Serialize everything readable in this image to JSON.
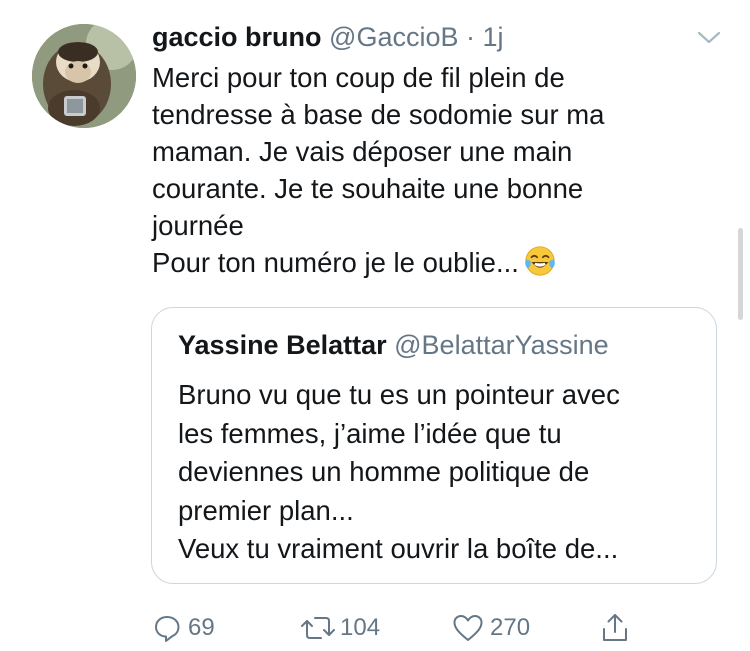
{
  "tweet": {
    "author_name": "gaccio bruno",
    "handle": "@GaccioB",
    "separator": "·",
    "time": "1j",
    "text_lines": [
      "Merci pour ton coup de fil plein de",
      "tendresse à base de sodomie sur ma",
      "maman. Je vais déposer une main",
      "courante. Je te souhaite une bonne",
      "journée",
      "Pour ton numéro je le oublie..."
    ],
    "emoji": "face-with-tears-of-joy"
  },
  "quoted_tweet": {
    "author_name": "Yassine Belattar",
    "handle": "@BelattarYassine",
    "text_lines": [
      "Bruno vu que tu es un pointeur avec",
      "les femmes, j’aime l’idée que tu",
      "deviennes un homme politique de",
      "premier plan...",
      "Veux tu vraiment ouvrir la boîte de..."
    ]
  },
  "actions": {
    "reply_count": "69",
    "retweet_count": "104",
    "like_count": "270"
  },
  "colors": {
    "text": "#14171a",
    "secondary": "#657786",
    "border": "#ccd6dd"
  }
}
